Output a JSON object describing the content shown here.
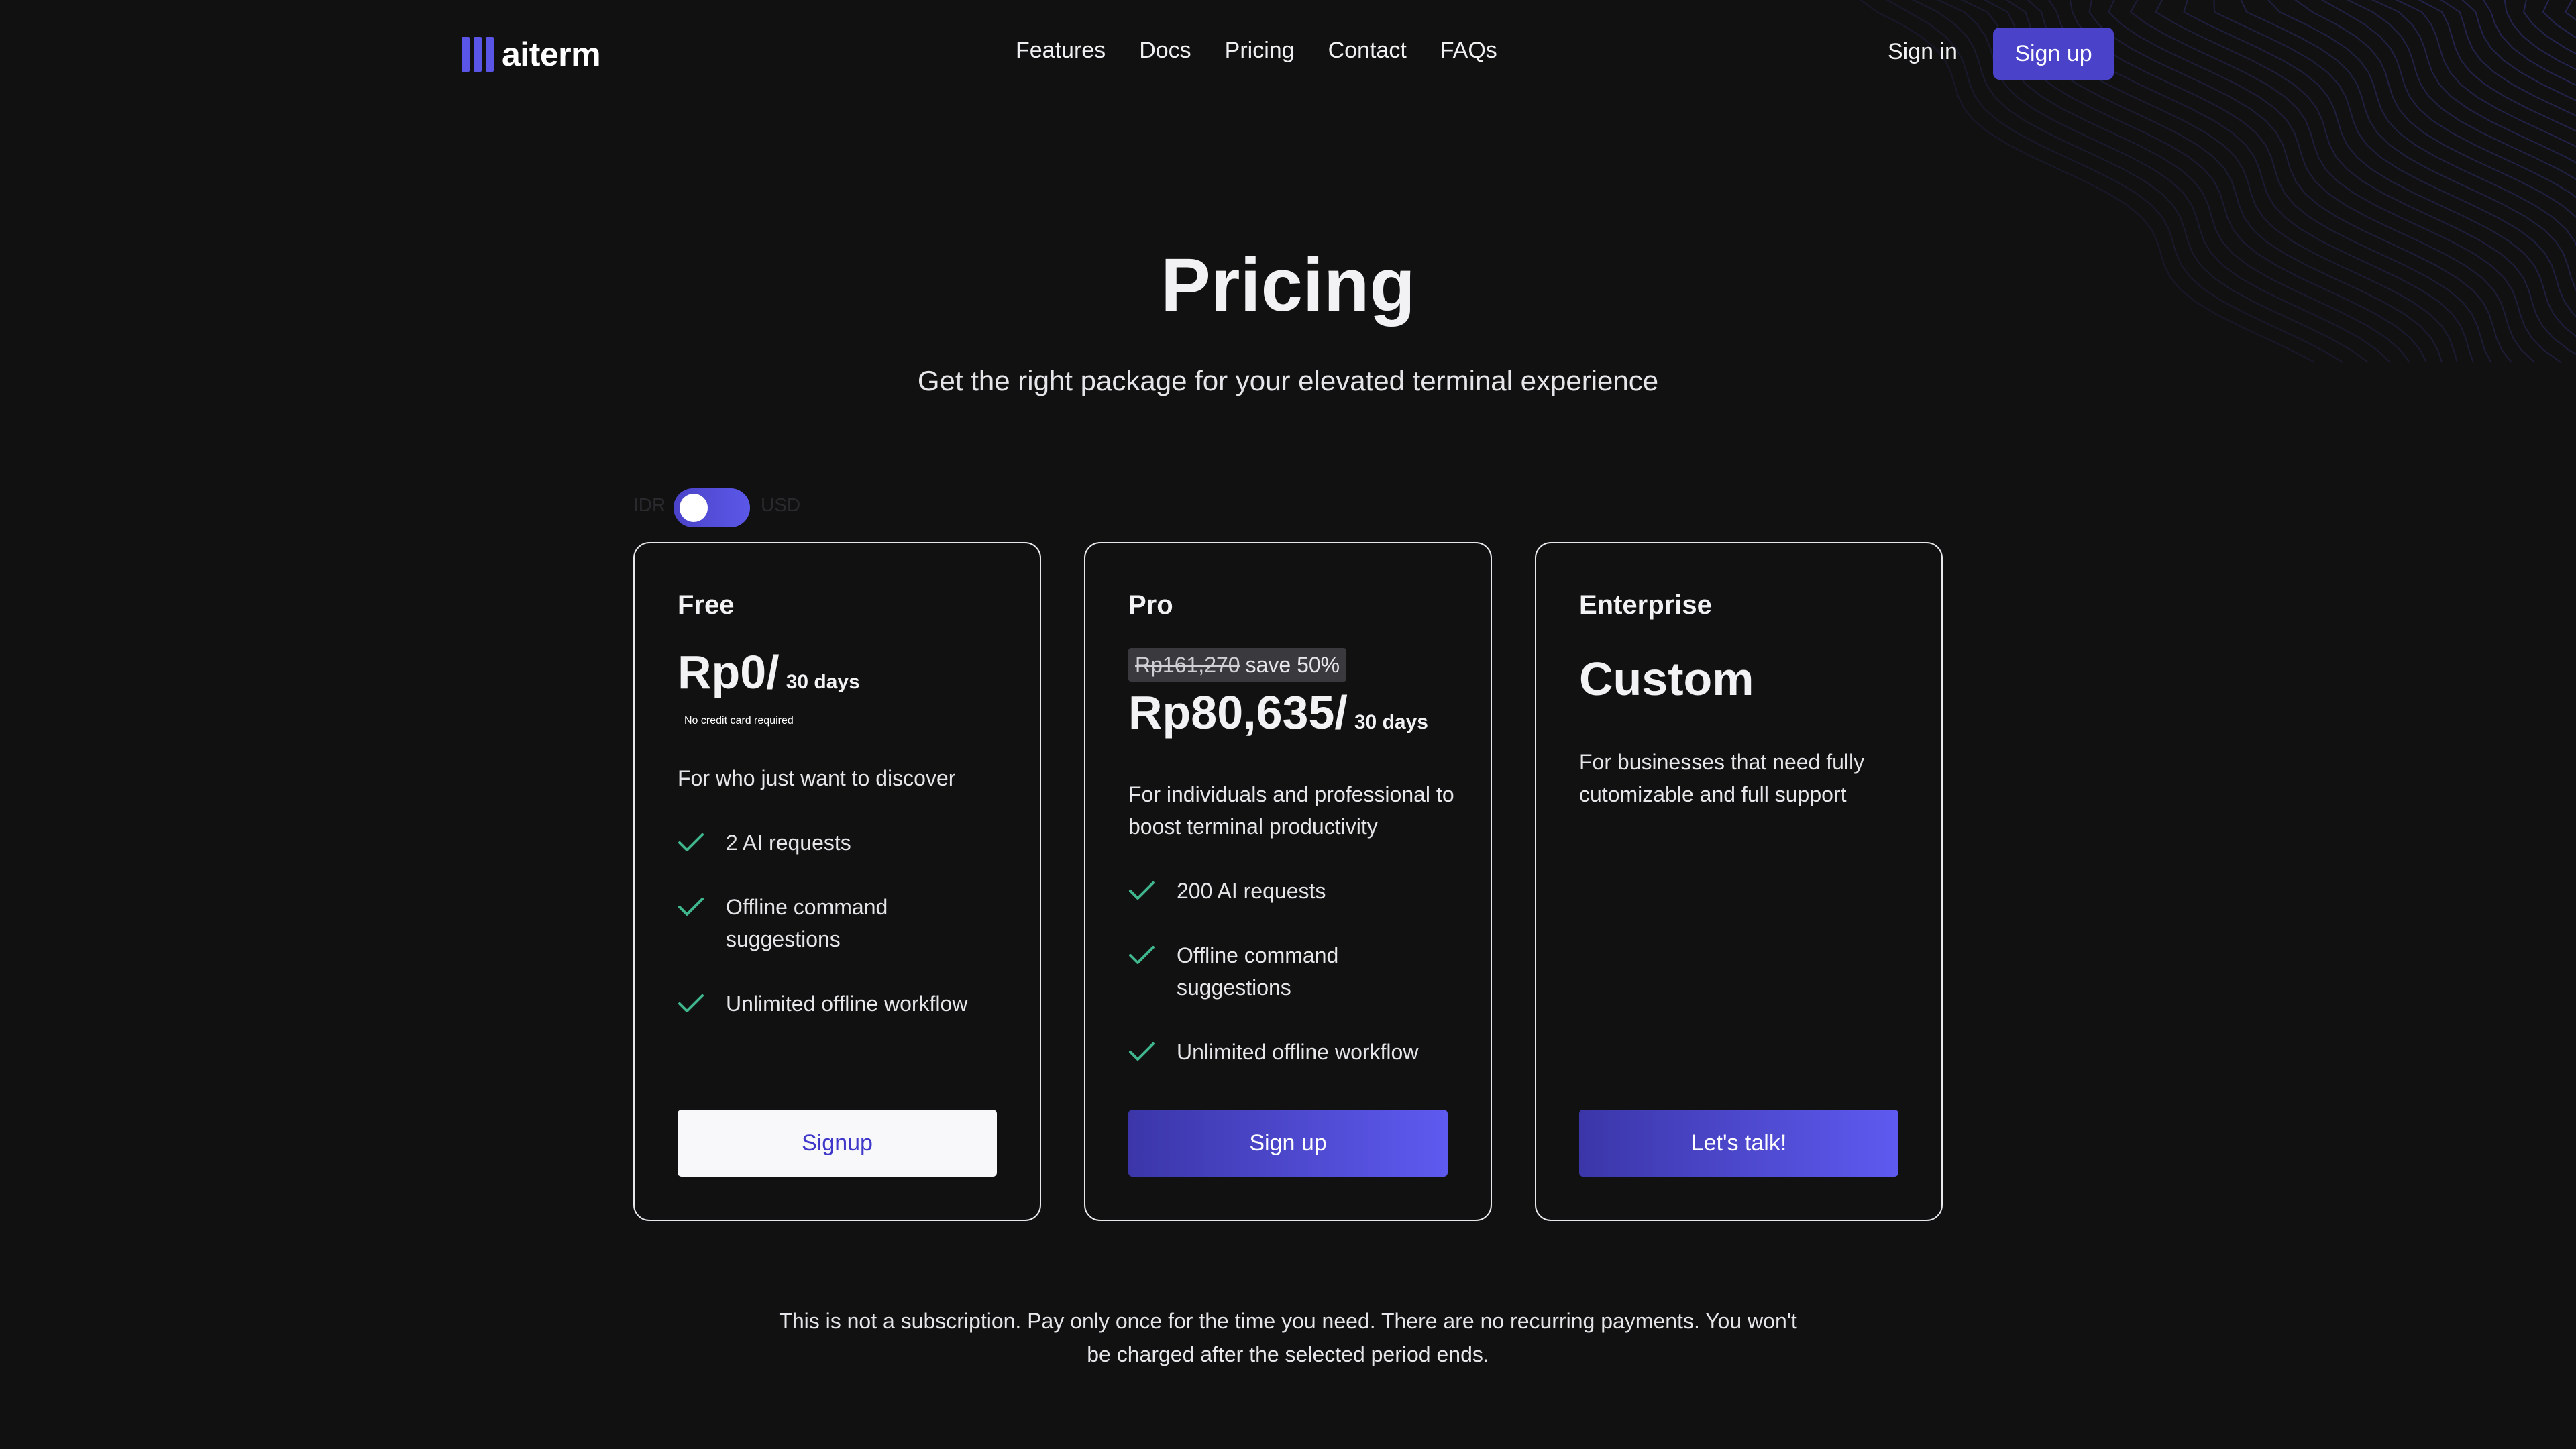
{
  "brand": {
    "name": "aiterm",
    "logo_icon": "bars-logo-icon",
    "accent_color": "#4a43c9"
  },
  "nav": {
    "links": [
      "Features",
      "Docs",
      "Pricing",
      "Contact",
      "FAQs"
    ],
    "signin_label": "Sign in",
    "signup_label": "Sign up"
  },
  "hero": {
    "title": "Pricing",
    "subtitle": "Get the right package for your elevated terminal experience"
  },
  "currency_toggle": {
    "left_label": "IDR",
    "right_label": "USD",
    "state": "off"
  },
  "plans": [
    {
      "name": "Free",
      "price": "Rp0/",
      "period": "30 days",
      "note": "No credit card required",
      "description": "For who just want to discover",
      "features": [
        "2 AI requests",
        "Offline command suggestions",
        "Unlimited offline workflow"
      ],
      "button": "Signup"
    },
    {
      "name": "Pro",
      "old_price": "Rp161,270",
      "discount": "save 50%",
      "price": "Rp80,635/",
      "period": "30 days",
      "description": "For individuals and professional to boost terminal productivity",
      "features": [
        "200 AI requests",
        "Offline command suggestions",
        "Unlimited offline workflow"
      ],
      "button": "Sign up"
    },
    {
      "name": "Enterprise",
      "price": "Custom",
      "description": "For businesses that need fully cutomizable and full support",
      "button": "Let's talk!"
    }
  ],
  "footnote": "This is not a subscription. Pay only once for the time you need. There are no recurring payments. You won't be charged after the selected period ends.",
  "icons": {
    "feature": "check-icon",
    "feature_color": "#3fb68b"
  }
}
